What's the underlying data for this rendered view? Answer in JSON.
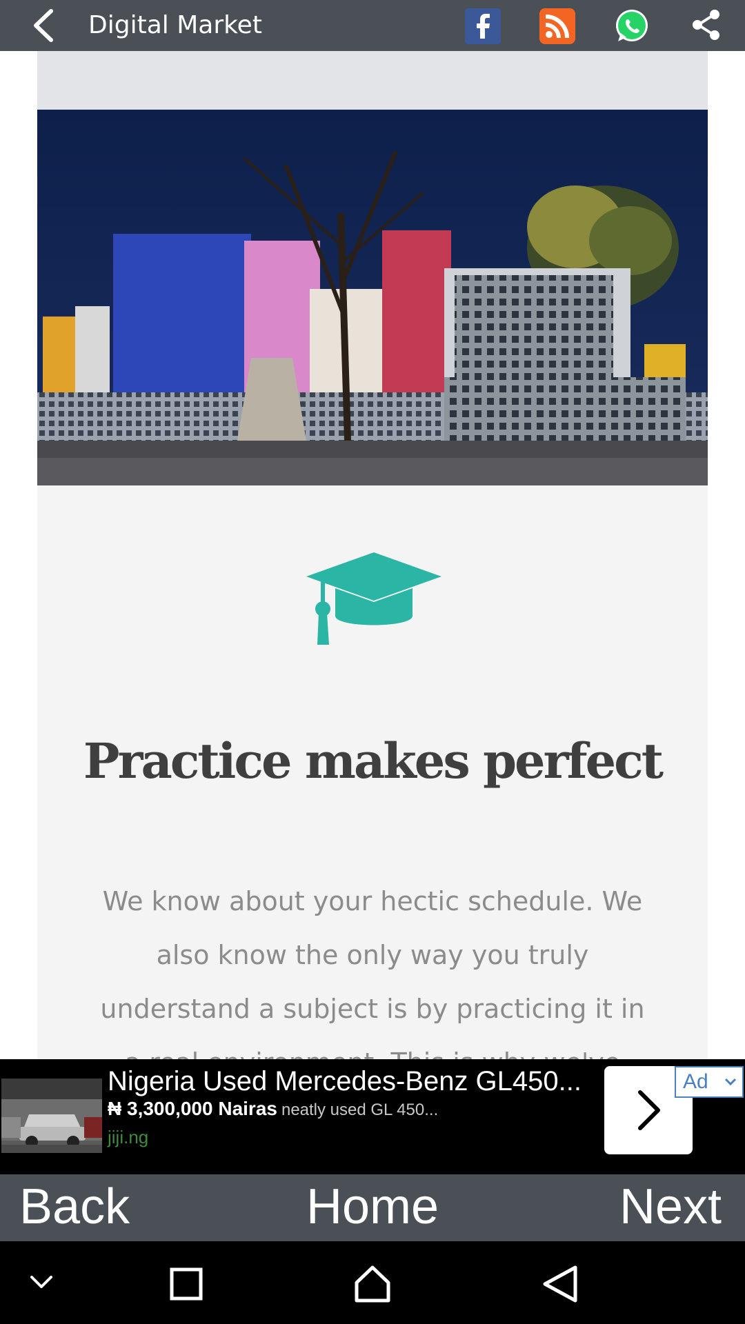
{
  "appbar": {
    "title": "Digital Market",
    "icons": [
      "back-arrow-icon",
      "facebook-icon",
      "rss-icon",
      "whatsapp-icon",
      "share-icon"
    ]
  },
  "content": {
    "heading": "Practice makes perfect",
    "paragraph": "We know about your hectic schedule. We also know the only way you truly understand a subject is by practicing it in a real environment. This is why we've",
    "icon": "graduation-cap-icon",
    "icon_color": "#2bb5a4"
  },
  "ad": {
    "title": "Nigeria Used Mercedes-Benz GL450...",
    "price": "₦ 3,300,000 Nairas",
    "description": "neatly used GL 450...",
    "domain": "jiji.ng",
    "badge": "Ad"
  },
  "bottom_nav": {
    "back": "Back",
    "home": "Home",
    "next": "Next"
  },
  "colors": {
    "appbar": "#4b5056",
    "heading": "#3f3f3f",
    "text": "#8b8b8b",
    "accent": "#2bb5a4"
  }
}
